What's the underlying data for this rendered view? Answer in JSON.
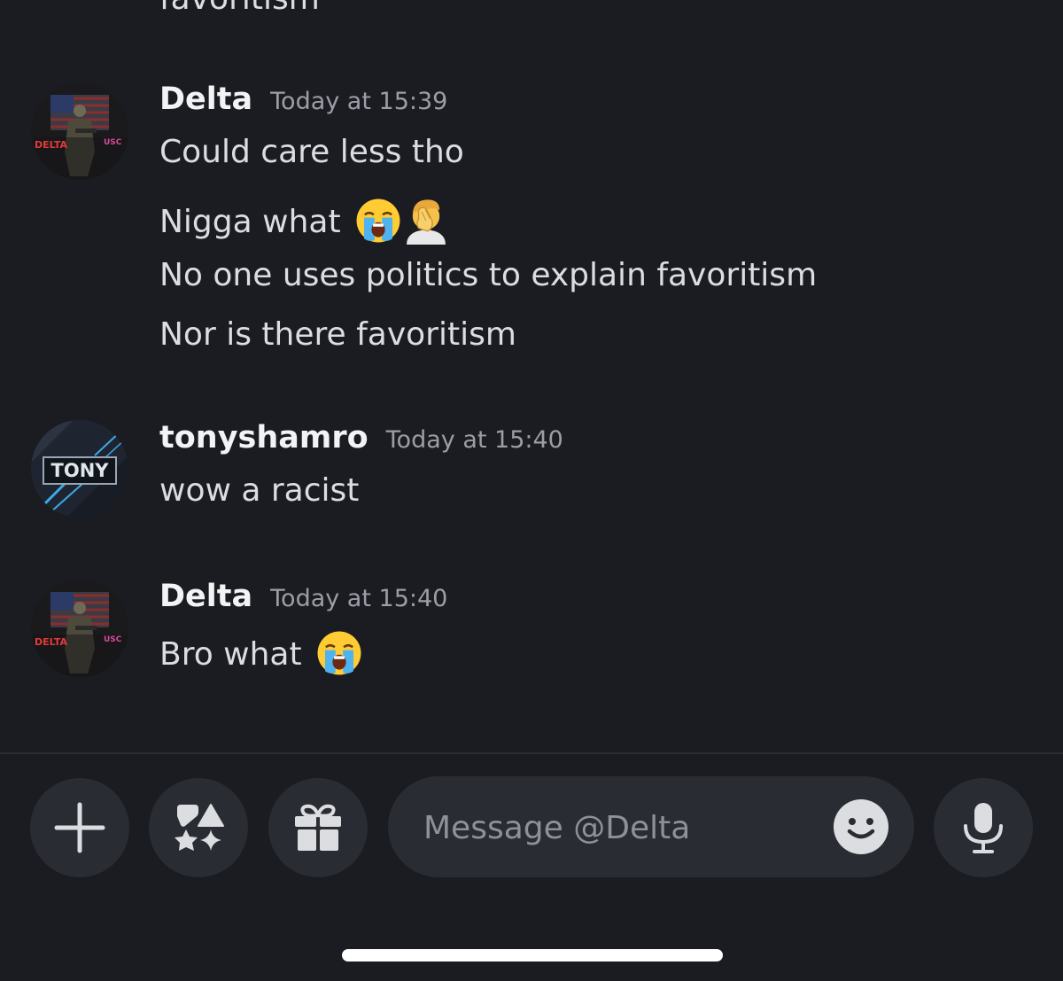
{
  "previous_fragment": "favoritism",
  "messages": [
    {
      "author": "Delta",
      "timestamp": "Today at 15:39",
      "avatar_text": "DELTA",
      "avatar_badge": "USC",
      "lines": [
        "Could care less tho",
        "Nigga what",
        "No one uses politics to explain favoritism",
        "Nor is there favoritism"
      ]
    },
    {
      "author": "tonyshamro",
      "timestamp": "Today at 15:40",
      "avatar_text": "TONY",
      "lines": [
        "wow a racist"
      ]
    },
    {
      "author": "Delta",
      "timestamp": "Today at 15:40",
      "avatar_text": "DELTA",
      "avatar_badge": "USC",
      "lines": [
        "Bro what"
      ]
    }
  ],
  "composer": {
    "placeholder": "Message @Delta"
  },
  "icons": {
    "add": "plus-icon",
    "apps": "apps-icon",
    "gift": "gift-icon",
    "emoji": "smiley-icon",
    "voice": "microphone-icon",
    "crying": "loudly-crying-face-emoji",
    "facepalm": "facepalm-emoji"
  },
  "colors": {
    "background": "#1b1c21",
    "button": "#2a2c33",
    "text": "#dcdde1",
    "username": "#f2f3f5",
    "timestamp": "#9b9ea6"
  }
}
